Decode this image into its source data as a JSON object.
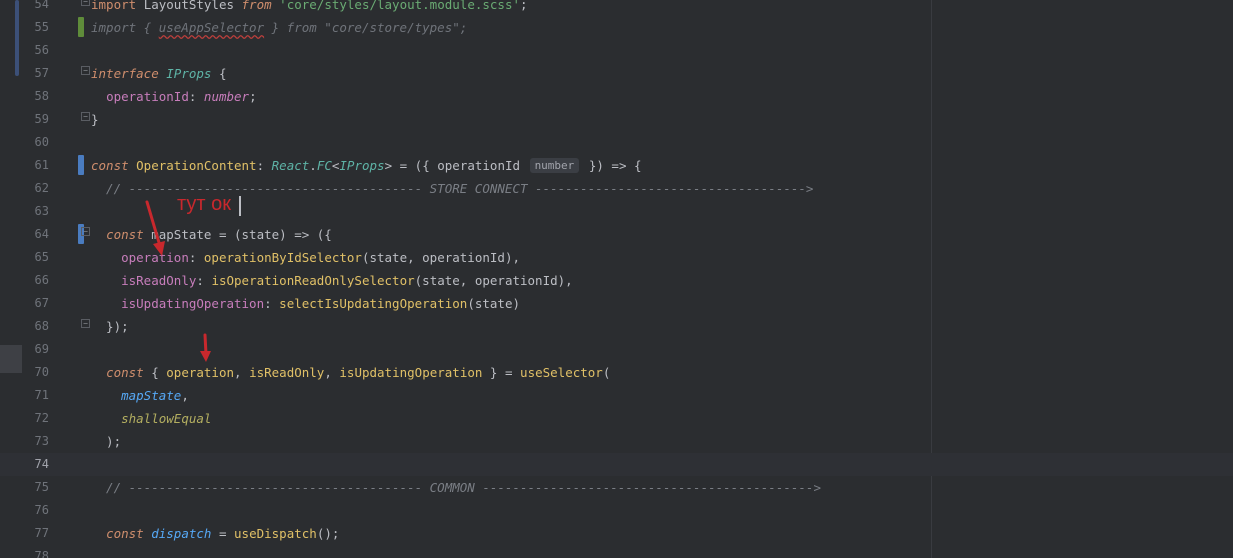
{
  "lines": [
    {
      "n": "54",
      "tokens": [
        [
          "kw2",
          "import "
        ],
        [
          "var",
          "LayoutStyles "
        ],
        [
          "kw",
          "from "
        ],
        [
          "str",
          "'core/styles/layout.module.scss'"
        ],
        [
          "var",
          ";"
        ]
      ]
    },
    {
      "n": "55",
      "tokens": [
        [
          "faded",
          "import { "
        ],
        [
          "faded under",
          "useAppSelector"
        ],
        [
          "faded",
          " } from \"core/store/types\";"
        ]
      ]
    },
    {
      "n": "56",
      "tokens": []
    },
    {
      "n": "57",
      "tokens": [
        [
          "kw",
          "interface "
        ],
        [
          "iface",
          "IProps "
        ],
        [
          "var",
          "{"
        ]
      ]
    },
    {
      "n": "58",
      "tokens": [
        [
          "var",
          "  "
        ],
        [
          "field",
          "operationId"
        ],
        [
          "var",
          ": "
        ],
        [
          "type",
          "number"
        ],
        [
          "var",
          ";"
        ]
      ]
    },
    {
      "n": "59",
      "tokens": [
        [
          "var",
          "}"
        ]
      ]
    },
    {
      "n": "60",
      "tokens": []
    },
    {
      "n": "61",
      "tokens": [
        [
          "kw",
          "const "
        ],
        [
          "fnc",
          "OperationContent"
        ],
        [
          "var",
          ": "
        ],
        [
          "iface",
          "React"
        ],
        [
          "var",
          "."
        ],
        [
          "iface",
          "FC"
        ],
        [
          "var",
          "<"
        ],
        [
          "iface",
          "IProps"
        ],
        [
          "var",
          "> = ({ operationId "
        ],
        [
          "hint",
          "number"
        ],
        [
          "var",
          " }) => {"
        ]
      ]
    },
    {
      "n": "62",
      "tokens": [
        [
          "cmt",
          "  // --------------------------------------- STORE CONNECT ------------------------------------>"
        ]
      ]
    },
    {
      "n": "63",
      "tokens": []
    },
    {
      "n": "64",
      "tokens": [
        [
          "var",
          "  "
        ],
        [
          "kw",
          "const "
        ],
        [
          "var",
          "mapState = (state) => ({"
        ]
      ]
    },
    {
      "n": "65",
      "tokens": [
        [
          "var",
          "    "
        ],
        [
          "field",
          "operation"
        ],
        [
          "var",
          ": "
        ],
        [
          "fnc",
          "operationByIdSelector"
        ],
        [
          "var",
          "(state, operationId),"
        ]
      ]
    },
    {
      "n": "66",
      "tokens": [
        [
          "var",
          "    "
        ],
        [
          "field",
          "isReadOnly"
        ],
        [
          "var",
          ": "
        ],
        [
          "fnc",
          "isOperationReadOnlySelector"
        ],
        [
          "var",
          "(state, operationId),"
        ]
      ]
    },
    {
      "n": "67",
      "tokens": [
        [
          "var",
          "    "
        ],
        [
          "field",
          "isUpdatingOperation"
        ],
        [
          "var",
          ": "
        ],
        [
          "fnc",
          "selectIsUpdatingOperation"
        ],
        [
          "var",
          "(state)"
        ]
      ]
    },
    {
      "n": "68",
      "tokens": [
        [
          "var",
          "  });"
        ]
      ]
    },
    {
      "n": "69",
      "tokens": []
    },
    {
      "n": "70",
      "tokens": [
        [
          "var",
          "  "
        ],
        [
          "kw",
          "const "
        ],
        [
          "var",
          "{ "
        ],
        [
          "fnc",
          "operation"
        ],
        [
          "var",
          ", "
        ],
        [
          "fnc",
          "isReadOnly"
        ],
        [
          "var",
          ", "
        ],
        [
          "fnc",
          "isUpdatingOperation"
        ],
        [
          "var",
          " } = "
        ],
        [
          "fnc",
          "useSelector"
        ],
        [
          "var",
          "("
        ]
      ]
    },
    {
      "n": "71",
      "tokens": [
        [
          "var",
          "    "
        ],
        [
          "mod",
          "mapState"
        ],
        [
          "var",
          ","
        ]
      ]
    },
    {
      "n": "72",
      "tokens": [
        [
          "var",
          "    "
        ],
        [
          "tname",
          "shallowEqual"
        ]
      ]
    },
    {
      "n": "73",
      "tokens": [
        [
          "var",
          "  );"
        ]
      ]
    },
    {
      "n": "74",
      "tokens": []
    },
    {
      "n": "75",
      "tokens": [
        [
          "cmt",
          "  // --------------------------------------- COMMON -------------------------------------------->"
        ]
      ]
    },
    {
      "n": "76",
      "tokens": []
    },
    {
      "n": "77",
      "tokens": [
        [
          "var",
          "  "
        ],
        [
          "kw",
          "const "
        ],
        [
          "mod",
          "dispatch"
        ],
        [
          "var",
          " = "
        ],
        [
          "fnc",
          "useDispatch"
        ],
        [
          "var",
          "();"
        ]
      ]
    },
    {
      "n": "78",
      "tokens": []
    }
  ],
  "annotation": {
    "text": "тут ок",
    "color": "#c8282d"
  },
  "current_line": "74"
}
